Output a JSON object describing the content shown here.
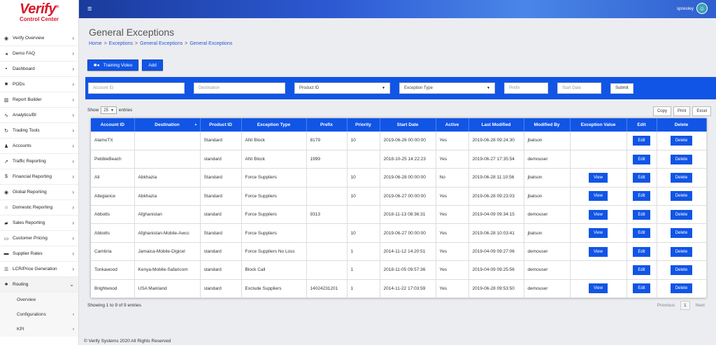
{
  "brand": {
    "name": "Verify",
    "mark": "®",
    "subtitle": "Control Center"
  },
  "sidebar": {
    "items": [
      {
        "label": "Verify Overview",
        "icon": "globe-icon",
        "glyph": "◉"
      },
      {
        "label": "Demo FAQ",
        "icon": "megaphone-icon",
        "glyph": "◂"
      },
      {
        "label": "Dashboard",
        "icon": "dashboard-icon",
        "glyph": "▪"
      },
      {
        "label": "PODs",
        "icon": "pods-icon",
        "glyph": "■"
      },
      {
        "label": "Report Builder",
        "icon": "columns-icon",
        "glyph": "▥"
      },
      {
        "label": "Analytics/BI",
        "icon": "line-chart-icon",
        "glyph": "∿"
      },
      {
        "label": "Trading Tools",
        "icon": "refresh-icon",
        "glyph": "↻"
      },
      {
        "label": "Accounts",
        "icon": "users-icon",
        "glyph": "♟"
      },
      {
        "label": "Traffic Reporting",
        "icon": "traffic-icon",
        "glyph": "➚"
      },
      {
        "label": "Financial Reporting",
        "icon": "dollar-icon",
        "glyph": "$"
      },
      {
        "label": "Global Reporting",
        "icon": "globe-icon",
        "glyph": "◉"
      },
      {
        "label": "Domestic Reporting",
        "icon": "home-icon",
        "glyph": "⌂"
      },
      {
        "label": "Sales Reporting",
        "icon": "cart-icon",
        "glyph": "▰"
      },
      {
        "label": "Customer Pricing",
        "icon": "money-icon",
        "glyph": "▭"
      },
      {
        "label": "Supplier Rates",
        "icon": "truck-icon",
        "glyph": "▬"
      },
      {
        "label": "LCR/Price Generation",
        "icon": "list-icon",
        "glyph": "☰"
      },
      {
        "label": "Routing",
        "icon": "sitemap-icon",
        "glyph": "♣"
      }
    ],
    "routing_sub": [
      {
        "label": "Overview"
      },
      {
        "label": "Configurations"
      },
      {
        "label": "KPI"
      }
    ]
  },
  "header": {
    "username": "spresley",
    "menu_icon": "≡"
  },
  "page": {
    "title": "General Exceptions",
    "breadcrumb": [
      "Home",
      "Exceptions",
      "General Exceptions",
      "General Exceptions"
    ],
    "breadcrumb_sep": ">",
    "training_video_label": "Training Video",
    "add_label": "Add"
  },
  "filters": {
    "account_id_placeholder": "Account ID",
    "destination_placeholder": "Destination",
    "product_id_label": "Product ID",
    "exception_type_label": "Exception Type",
    "prefix_placeholder": "Prefix",
    "start_date_placeholder": "Start Date",
    "submit_label": "Submit"
  },
  "table_controls": {
    "show_label": "Show",
    "show_value": "25",
    "entries_label": "entries",
    "copy_label": "Copy",
    "print_label": "Print",
    "excel_label": "Excel"
  },
  "table": {
    "columns": [
      "Account ID",
      "Destination",
      "Product ID",
      "Exception Type",
      "Prefix",
      "Priority",
      "Start Date",
      "Active",
      "Last Modified",
      "Modified By",
      "Exception Value",
      "Edit",
      "Delete"
    ],
    "rows": [
      {
        "account": "AlamoTX",
        "destination": "",
        "product": "Standard",
        "type": "ANI Block",
        "prefix": "8179",
        "priority": "10",
        "start": "2019-06-26 00:00:00",
        "active": "Yes",
        "modified": "2019-06-28 09:24:30",
        "by": "jbatson",
        "view": false
      },
      {
        "account": "PebbleBeach",
        "destination": "",
        "product": "standard",
        "type": "ANI Block",
        "prefix": "1999",
        "priority": "",
        "start": "2018-10-25 14:22:23",
        "active": "Yes",
        "modified": "2019-06-27 17:35:54",
        "by": "demouser",
        "view": false
      },
      {
        "account": "All",
        "destination": "Abkhazia",
        "product": "Standard",
        "type": "Force Suppliers",
        "prefix": "",
        "priority": "10",
        "start": "2019-06-28 00:00:00",
        "active": "No",
        "modified": "2019-06-28 11:10:56",
        "by": "jbatson",
        "view": true
      },
      {
        "account": "Allegiance",
        "destination": "Abkhazia",
        "product": "Standard",
        "type": "Force Suppliers",
        "prefix": "",
        "priority": "10",
        "start": "2019-06-27 00:00:00",
        "active": "Yes",
        "modified": "2019-06-28 09:23:03",
        "by": "jbatson",
        "view": true
      },
      {
        "account": "Abbotts",
        "destination": "Afghanistan",
        "product": "standard",
        "type": "Force Suppliers",
        "prefix": "9313",
        "priority": "",
        "start": "2018-11-13 08:36:31",
        "active": "Yes",
        "modified": "2019-04-09 09:34:15",
        "by": "demouser",
        "view": true
      },
      {
        "account": "Abbotts",
        "destination": "Afghanistan-Mobile-Awcc",
        "product": "Standard",
        "type": "Force Suppliers",
        "prefix": "",
        "priority": "10",
        "start": "2019-06-27 00:00:00",
        "active": "Yes",
        "modified": "2019-06-28 10:03:41",
        "by": "jbatson",
        "view": true
      },
      {
        "account": "Cambria",
        "destination": "Jamaica-Mobile-Digicel",
        "product": "standard",
        "type": "Force Suppliers No Loss",
        "prefix": "",
        "priority": "1",
        "start": "2014-11-12 14:20:51",
        "active": "Yes",
        "modified": "2019-04-09 09:27:06",
        "by": "demouser",
        "view": true
      },
      {
        "account": "Tonkawood",
        "destination": "Kenya-Mobile-Safaricom",
        "product": "standard",
        "type": "Block Call",
        "prefix": "",
        "priority": "1",
        "start": "2018-11-05 09:57:36",
        "active": "Yes",
        "modified": "2019-04-09 09:25:56",
        "by": "demouser",
        "view": false
      },
      {
        "account": "Brightwood",
        "destination": "USA Mainland",
        "product": "standard",
        "type": "Exclude Suppliers",
        "prefix": "14024231201",
        "priority": "1",
        "start": "2014-11-22 17:03:59",
        "active": "Yes",
        "modified": "2019-06-28 09:53:50",
        "by": "demouser",
        "view": true
      }
    ],
    "view_label": "View",
    "edit_label": "Edit",
    "delete_label": "Delete"
  },
  "pagination": {
    "info": "Showing 1 to 9 of 9 entries",
    "previous_label": "Previous",
    "current_page": "1",
    "next_label": "Next"
  },
  "footer": {
    "text": "© Verify Systems 2020 All Rights Reserved"
  },
  "colors": {
    "primary": "#1155e6",
    "brand_red": "#d7182a"
  }
}
